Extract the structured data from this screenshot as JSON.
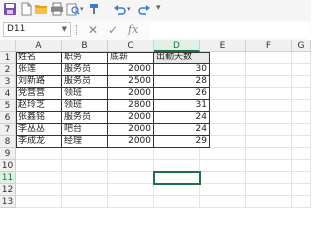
{
  "toolbar": {
    "icons": [
      "save-icon",
      "new-file-icon",
      "open-folder-icon",
      "print-icon",
      "print-preview-icon",
      "undo-icon",
      "redo-icon",
      "more-icon"
    ],
    "colors": {
      "save": "#7b4fb0",
      "folder": "#e8a316",
      "accent": "#1e7145"
    }
  },
  "formula_bar": {
    "name_box": "D11",
    "fx": "fx",
    "cancel": "✕",
    "confirm": "✓",
    "formula_value": ""
  },
  "sheet": {
    "columns": [
      "A",
      "B",
      "C",
      "D",
      "E",
      "F",
      "G"
    ],
    "rows": [
      "1",
      "2",
      "3",
      "4",
      "5",
      "6",
      "7",
      "8",
      "9",
      "10",
      "11",
      "12",
      "13"
    ],
    "selected_cell": "D11",
    "table": {
      "headers": [
        "姓名",
        "职务",
        "底薪",
        "出勤天数"
      ],
      "data": [
        [
          "张莲",
          "服务员",
          "2000",
          "30"
        ],
        [
          "刘新路",
          "服务员",
          "2500",
          "28"
        ],
        [
          "党营营",
          "领班",
          "2000",
          "26"
        ],
        [
          "赵玲芝",
          "领班",
          "2800",
          "31"
        ],
        [
          "张鑫铭",
          "服务员",
          "2000",
          "24"
        ],
        [
          "李丛丛",
          "吧台",
          "2000",
          "24"
        ],
        [
          "李成龙",
          "经理",
          "2000",
          "29"
        ]
      ]
    }
  }
}
